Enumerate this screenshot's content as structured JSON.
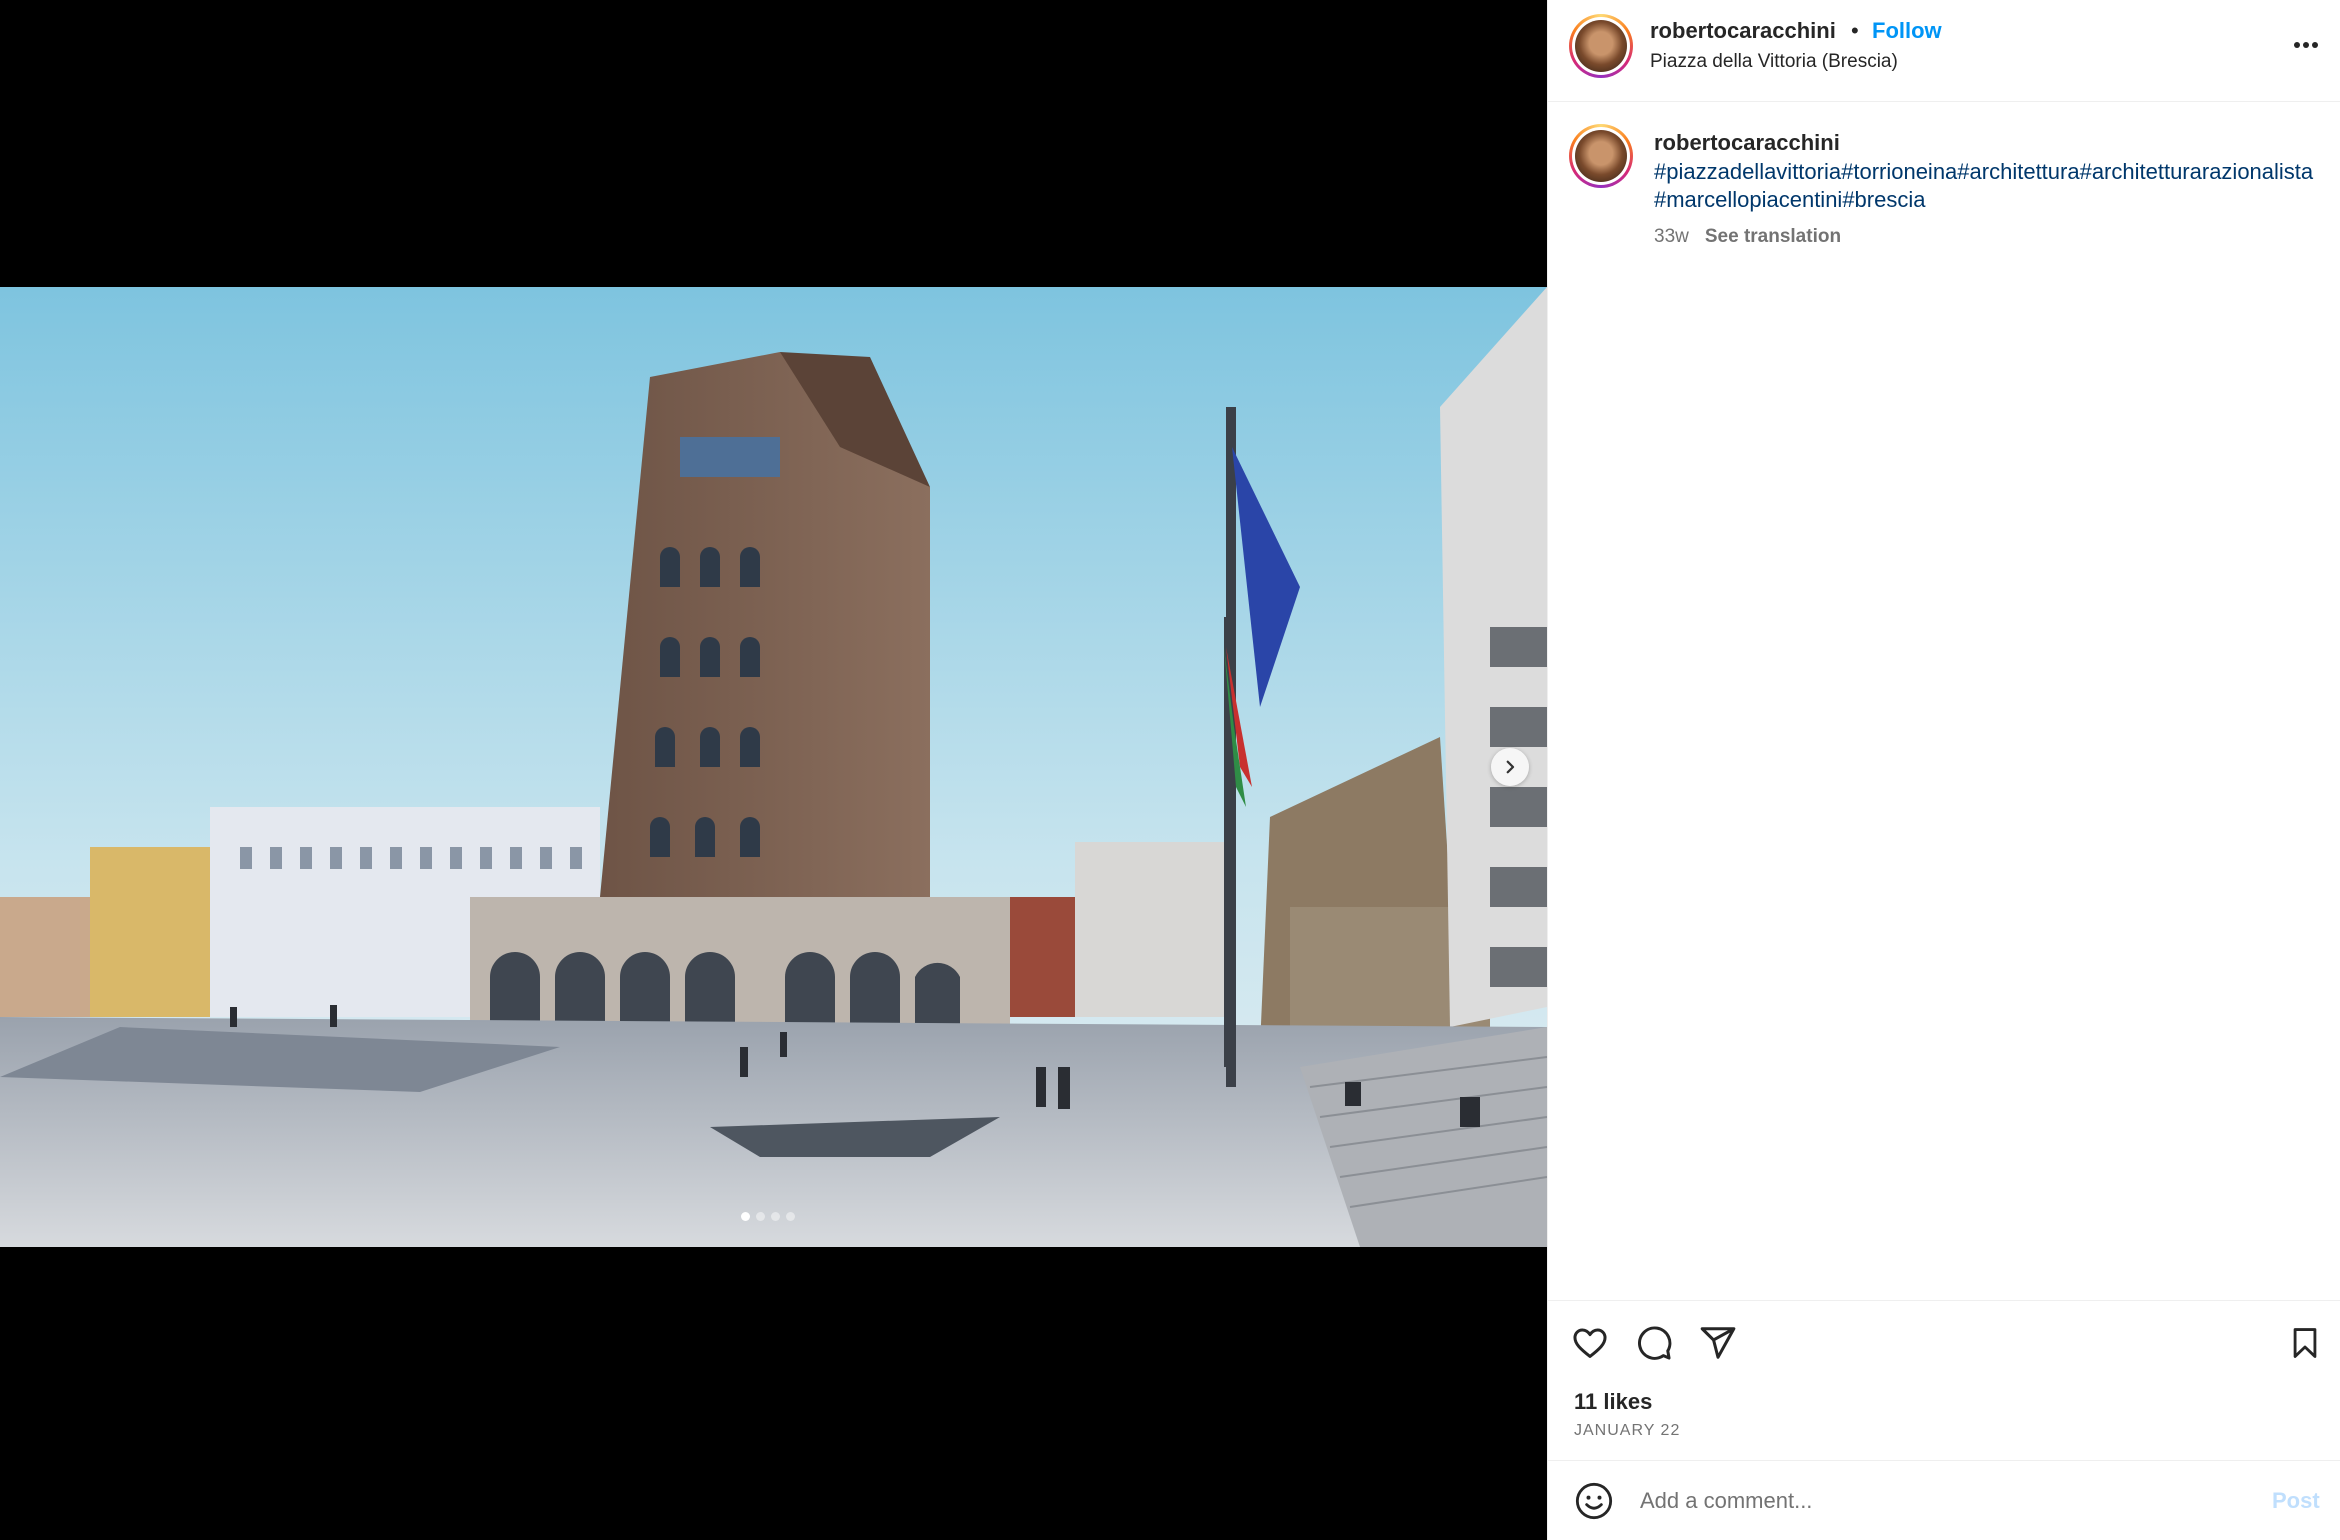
{
  "post": {
    "username": "robertocaracchini",
    "follow_label": "Follow",
    "separator": "•",
    "location": "Piazza della Vittoria (Brescia)"
  },
  "caption": {
    "username": "robertocaracchini",
    "hashtags": "#piazzadellavittoria#torrioneina#architettura#architetturarazionalista#marcellopiacentini#brescia",
    "age": "33w",
    "see_translation": "See translation"
  },
  "media": {
    "slides_total": 4,
    "slide_active": 1,
    "next_icon": "chevron-right-icon"
  },
  "engagement": {
    "likes": "11 likes",
    "date": "JANUARY 22"
  },
  "comment": {
    "placeholder": "Add a comment...",
    "post_label": "Post"
  },
  "colors": {
    "link": "#0095f6",
    "hashtag": "#00376b",
    "post_disabled": "#c0dffd"
  }
}
